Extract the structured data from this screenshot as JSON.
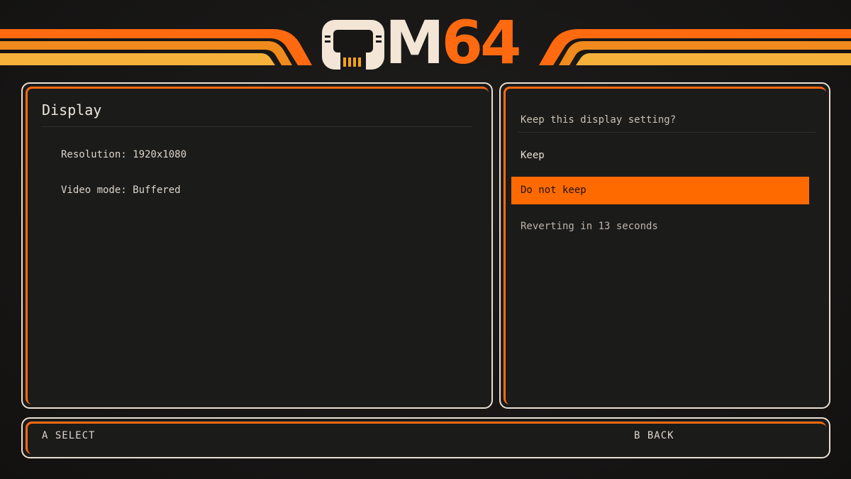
{
  "header": {
    "logo_letter": "M",
    "logo_number": "64",
    "logo_name": "OM64"
  },
  "colors": {
    "accent": "#ff6a10",
    "stripe_mid": "#f08a1c",
    "stripe_light": "#f5b13a",
    "panel_border": "#e9dfd2",
    "background": "#181716"
  },
  "left_panel": {
    "title": "Display",
    "settings": [
      "Resolution: 1920x1080",
      "Video mode: Buffered"
    ]
  },
  "right_panel": {
    "prompt": "Keep this display setting?",
    "options": [
      "Keep",
      "Do not keep"
    ],
    "selected_option": "Do not keep",
    "countdown": "Reverting in 13 seconds"
  },
  "footer": {
    "select_hint": "A SELECT",
    "back_hint": "B BACK"
  },
  "icons": {
    "logo_icon": "cartridge-icon"
  }
}
